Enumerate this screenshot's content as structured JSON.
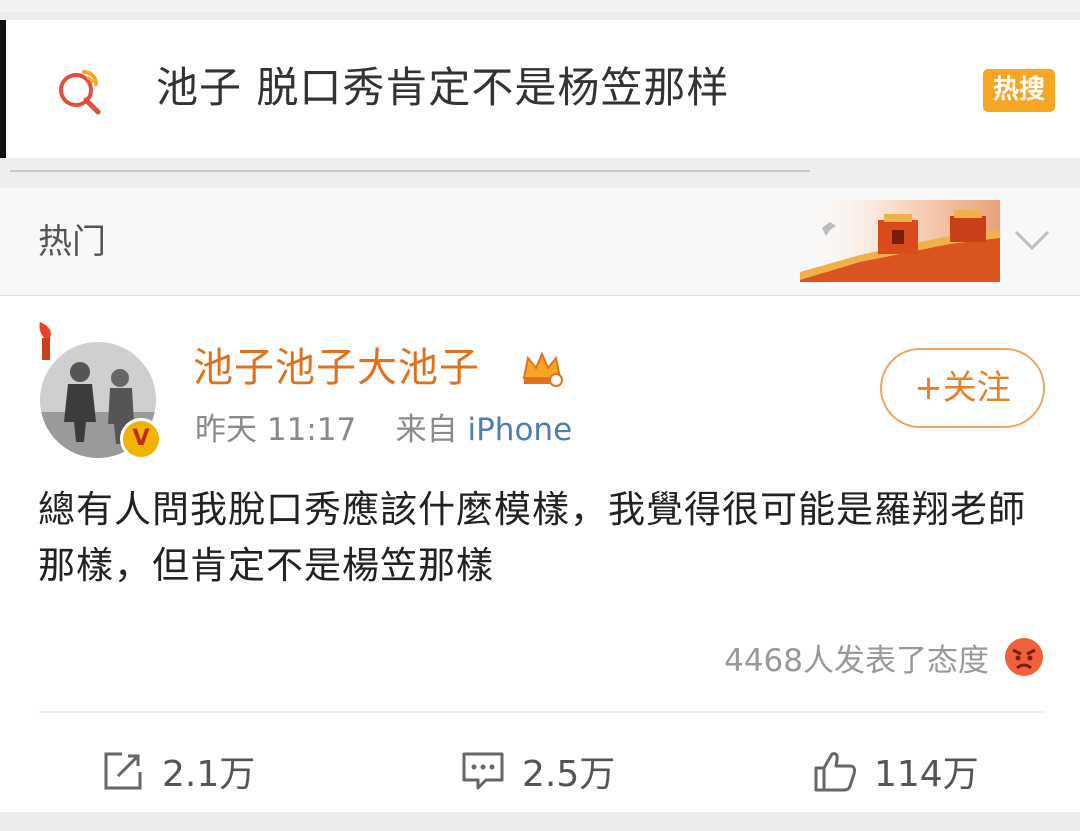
{
  "search": {
    "query": "池子 脱口秀肯定不是杨笠那样",
    "badge": "热搜"
  },
  "section": {
    "title": "热门"
  },
  "post": {
    "username": "池子池子大池子",
    "verified_mark": "V",
    "time": "昨天 11:17",
    "source_prefix": "来自",
    "source": "iPhone",
    "follow_label": "+关注",
    "text": "總有人問我脫口秀應該什麼模樣，我覺得很可能是羅翔老師那樣，但肯定不是楊笠那樣",
    "reactions_text": "4468人发表了态度",
    "reaction_icon": "angry-face-icon"
  },
  "actions": {
    "repost_count": "2.1万",
    "comment_count": "2.5万",
    "like_count": "114万"
  },
  "colors": {
    "accent_orange": "#e2711d",
    "hot_badge": "#f6a623",
    "source_blue": "#4b7fb3"
  }
}
